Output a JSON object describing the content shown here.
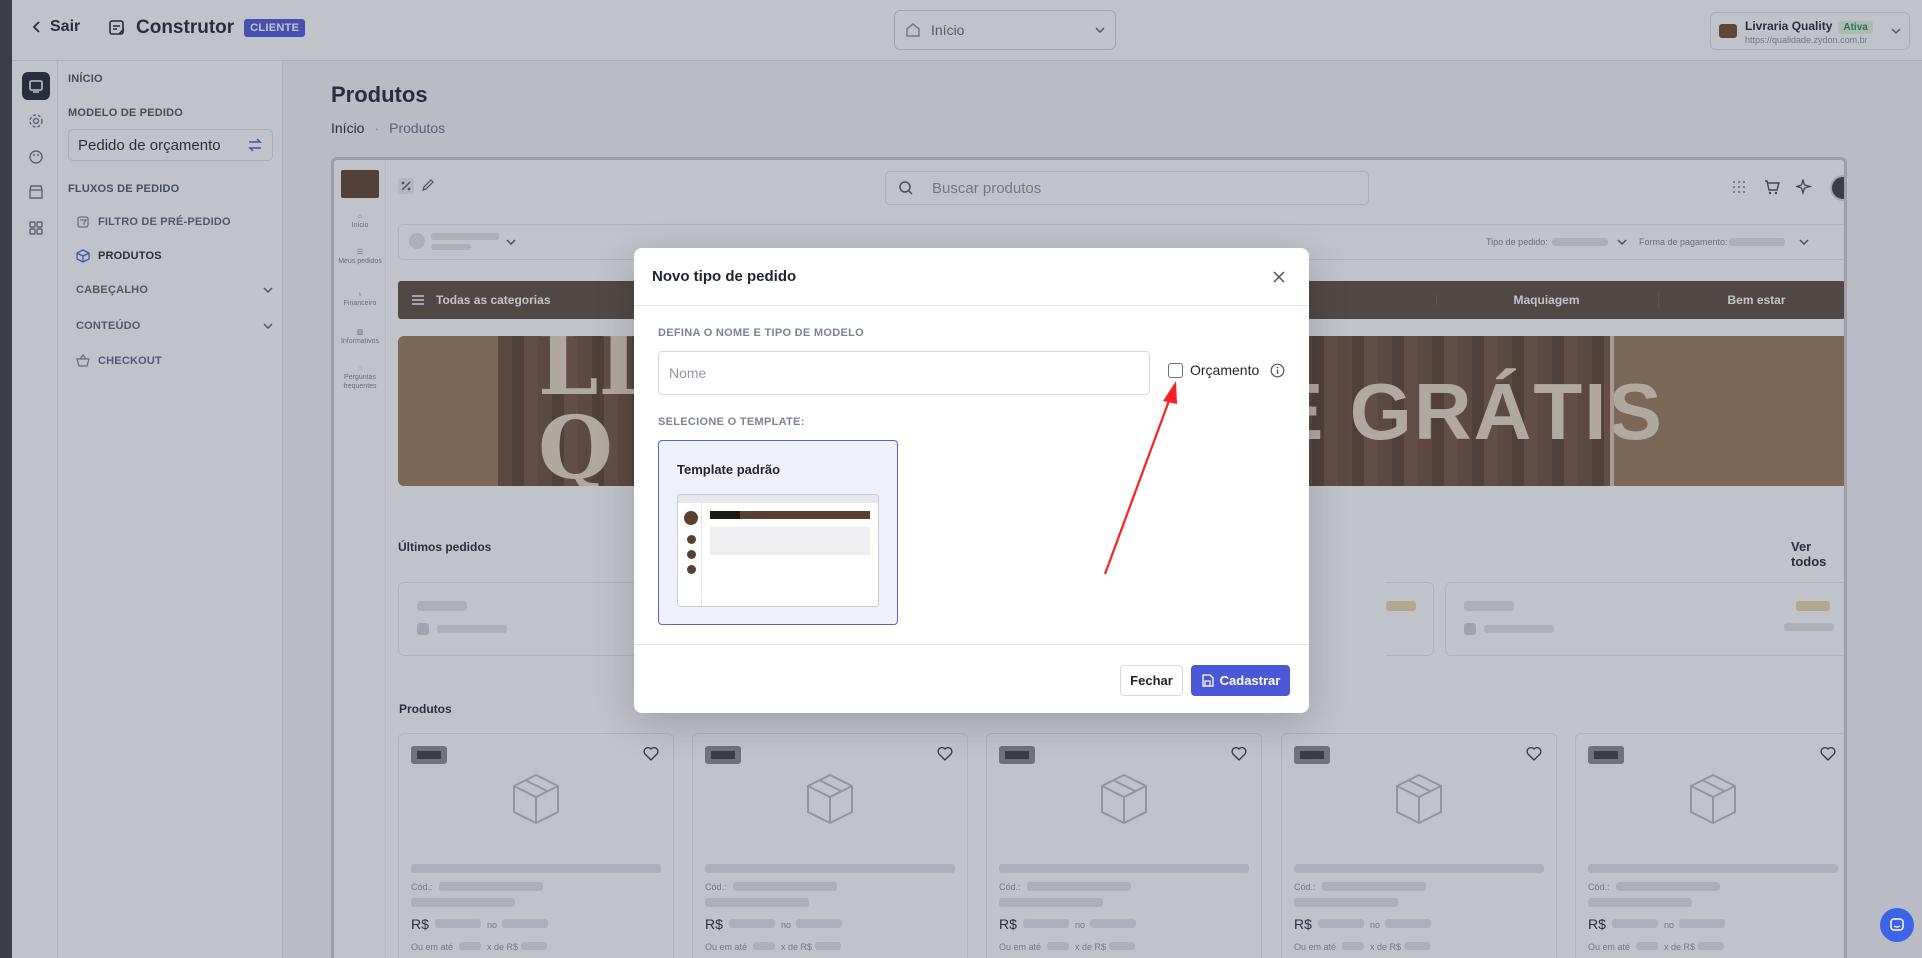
{
  "topbar": {
    "back_label": "Sair",
    "app_title": "Construtor",
    "app_badge": "CLIENTE",
    "page_select_value": "Início",
    "store_name": "Livraria Quality",
    "store_status": "Ativa",
    "store_url": "https://qualidade.zydon.com.br"
  },
  "sidebar": {
    "inicio_label": "INÍCIO",
    "model_label": "MODELO DE PEDIDO",
    "model_value": "Pedido de orçamento",
    "flows_label": "FLUXOS DE PEDIDO",
    "items": [
      {
        "label": "FILTRO DE PRÉ-PEDIDO"
      },
      {
        "label": "PRODUTOS"
      },
      {
        "label": "CABEÇALHO"
      },
      {
        "label": "CONTEÚDO"
      },
      {
        "label": "CHECKOUT"
      }
    ]
  },
  "main": {
    "title": "Produtos",
    "breadcrumb": [
      "Início",
      "Produtos"
    ]
  },
  "preview": {
    "nav": [
      "Início",
      "Meus pedidos",
      "Financeiro",
      "Informativos",
      "Perguntas frequentes"
    ],
    "search_placeholder": "Buscar produtos",
    "order_type_label": "Tipo de pedido:",
    "payment_label": "Forma de pagamento:",
    "categories": [
      "Todas as categorias",
      "Maquiagem",
      "Bem estar"
    ],
    "banner_text_left_1": "LI",
    "banner_text_left_2": "Q",
    "banner_text_right": "E GRÁTIS",
    "last_orders_title": "Últimos pedidos",
    "see_all": "Ver todos",
    "products_title": "Produtos",
    "product_code_label": "Cód.:",
    "product_price_label": "R$",
    "product_no_label": "no",
    "product_installment_prefix": "Ou em até",
    "product_installment_mid": "x de R$"
  },
  "modal": {
    "title": "Novo tipo de pedido",
    "section_name_label": "DEFINA O NOME E TIPO DE MODELO",
    "name_placeholder": "Nome",
    "name_value": "",
    "checkbox_label": "Orçamento",
    "template_label": "SELECIONE O TEMPLATE:",
    "template_name": "Template padrão",
    "close_button": "Fechar",
    "save_button": "Cadastrar"
  },
  "colors": {
    "accent": "#4a57d6",
    "annotation_arrow": "#ff1f1f",
    "brand_brown": "#5a4a3a"
  }
}
